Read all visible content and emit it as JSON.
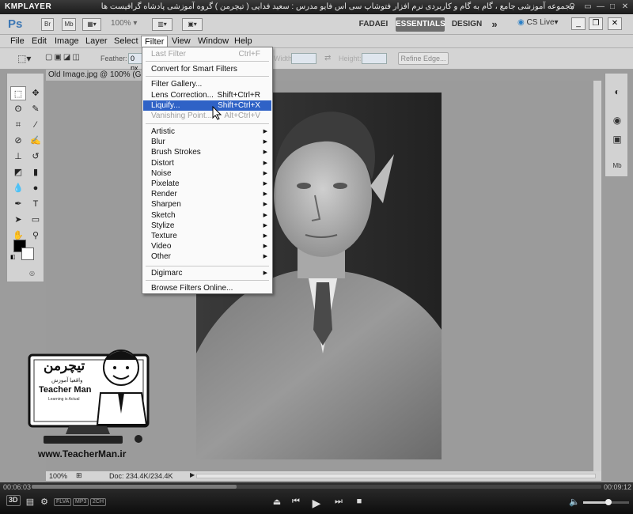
{
  "player": {
    "logo": "KMPLAYER",
    "caption": "مجموعه آموزشی جامع ، گام به گام و کاربردی نرم افزار فتوشاپ سی اس فایو  مدرس : سعید فدایی ( تیچرمن ) گروه آموزشی پادشاه گرافیست ها",
    "elapsed": "00:06:03",
    "total": "00:09:12",
    "progress": 0.36,
    "badges": [
      "FLVA",
      "MP3",
      "2CH"
    ],
    "volume": 0.55,
    "threed_label": "3D"
  },
  "appbar": {
    "ps_logo": "Ps",
    "br_label": "Br",
    "mb_label": "Mb",
    "zoom": "100%",
    "workspaces": [
      "FADAEI",
      "ESSENTIALS",
      "DESIGN"
    ],
    "more": "»",
    "cs_live": "CS Live▾"
  },
  "menubar": {
    "items": [
      "File",
      "Edit",
      "Image",
      "Layer",
      "Select",
      "Filter",
      "View",
      "Window",
      "Help"
    ]
  },
  "options": {
    "feather_label": "Feather:",
    "feather_value": "0 px",
    "width_label": "Width:",
    "height_label": "Height:",
    "refine_edge": "Refine Edge..."
  },
  "document": {
    "tab_title": "Old Image.jpg @ 100% (Gr",
    "zoom": "100%",
    "doc_info": "Doc: 234.4K/234.4K"
  },
  "filter_menu": {
    "last_filter": {
      "label": "Last Filter",
      "shortcut": "Ctrl+F"
    },
    "convert": "Convert for Smart Filters",
    "gallery": "Filter Gallery...",
    "lens": {
      "label": "Lens Correction...",
      "shortcut": "Shift+Ctrl+R"
    },
    "liquify": {
      "label": "Liquify...",
      "shortcut": "Shift+Ctrl+X"
    },
    "vanishing": {
      "label": "Vanishing Point...",
      "shortcut": "Alt+Ctrl+V"
    },
    "submenus": [
      "Artistic",
      "Blur",
      "Brush Strokes",
      "Distort",
      "Noise",
      "Pixelate",
      "Render",
      "Sharpen",
      "Sketch",
      "Stylize",
      "Texture",
      "Video",
      "Other"
    ],
    "digimarc": "Digimarc",
    "browse": "Browse Filters Online..."
  },
  "watermark": {
    "persian": "تیچرمن",
    "tagline": "واقعیا آموزش",
    "name": "Teacher Man",
    "slogan": "Learning is Actual",
    "url": "www.TeacherMan.ir"
  },
  "colors": {
    "highlight": "#2f62c6",
    "appbar": "#d4d4d4",
    "workspace": "#9c9c9c"
  }
}
